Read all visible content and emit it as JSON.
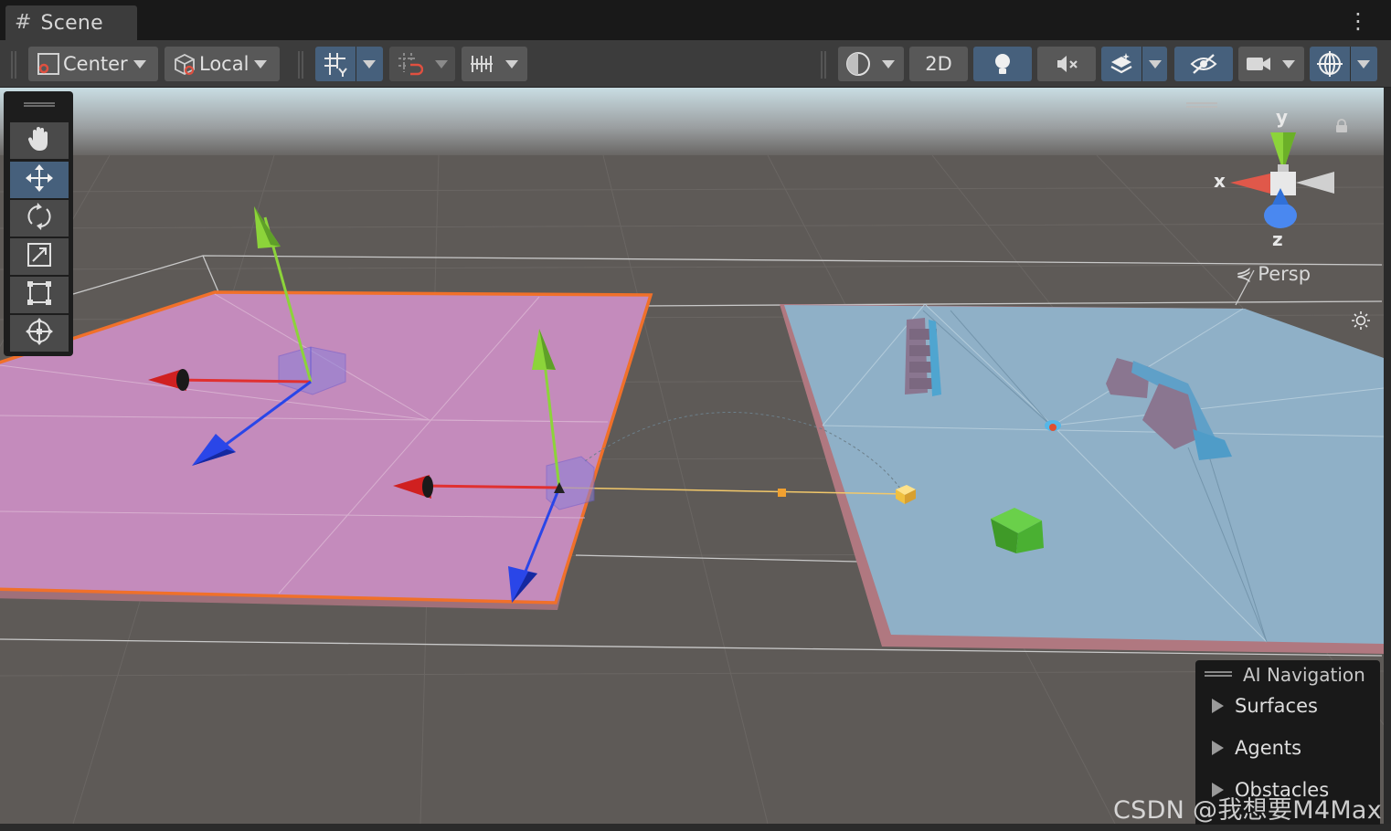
{
  "window": {
    "tab_title": "Scene",
    "tab_icon": "grid-hash-icon"
  },
  "toolbar": {
    "pivot_mode": "Center",
    "pivot_rotation": "Local",
    "view_2d_label": "2D",
    "accent_active": "#46607c"
  },
  "tools": [
    "hand",
    "move",
    "rotate",
    "scale",
    "rect",
    "transform"
  ],
  "gizmo": {
    "axis_labels": {
      "x": "x",
      "y": "y",
      "z": "z"
    },
    "projection_label": "Persp"
  },
  "ai_navigation": {
    "title": "AI Navigation",
    "items": [
      "Surfaces",
      "Agents",
      "Obstacles"
    ]
  },
  "watermark": "CSDN @我想要M4Max",
  "colors": {
    "ground": "#5e5a57",
    "pink_plane": "#c48bbc",
    "blue_navmesh": "#8fb0c7",
    "selection_outline": "#f0702a",
    "axis_x": "#e03030",
    "axis_y": "#8cd43a",
    "axis_z": "#2a46e8"
  }
}
